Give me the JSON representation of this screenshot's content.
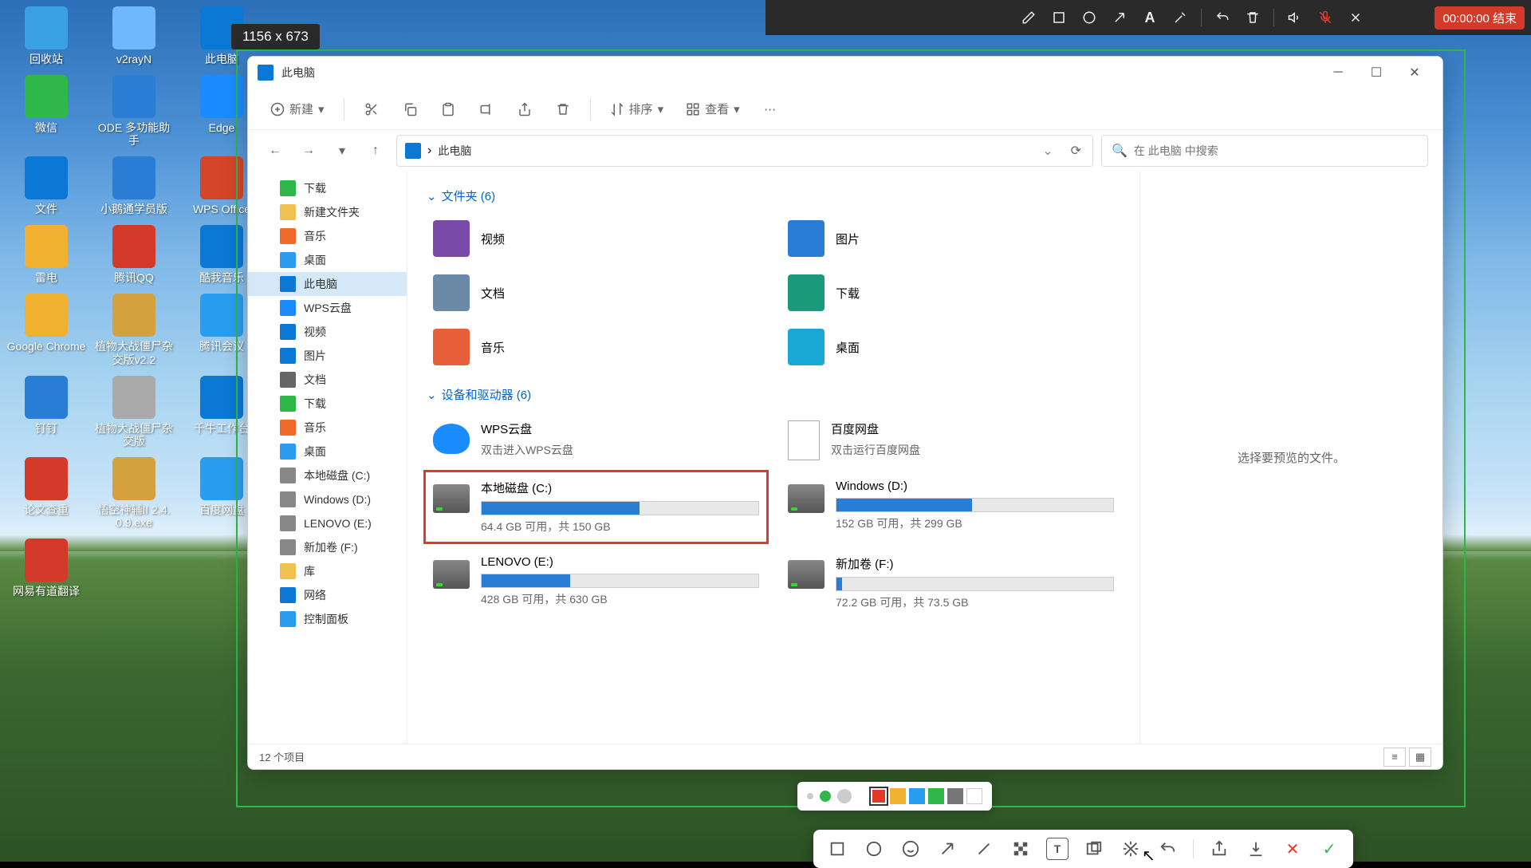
{
  "selection_label": "1156 x 673",
  "recording_time": "00:00:00 结束",
  "desktop_icons": [
    {
      "label": "回收站",
      "color": "#3aa0e4"
    },
    {
      "label": "v2rayN",
      "color": "#6fb8ff"
    },
    {
      "label": "此电脑",
      "color": "#0a78d4"
    },
    {
      "label": "微信",
      "color": "#2fb84a"
    },
    {
      "label": "ODE 多功能助手",
      "color": "#2a7dd4"
    },
    {
      "label": "Edge",
      "color": "#1a8cff"
    },
    {
      "label": "文件",
      "color": "#0a78d4"
    },
    {
      "label": "小鹅通学员版",
      "color": "#2a7dd4"
    },
    {
      "label": "WPS Office",
      "color": "#d4452a"
    },
    {
      "label": "雷电",
      "color": "#f0b030"
    },
    {
      "label": "腾讯QQ",
      "color": "#d43a2a"
    },
    {
      "label": "酷我音乐",
      "color": "#0a78d4"
    },
    {
      "label": "Google Chrome",
      "color": "#f0b030"
    },
    {
      "label": "植物大战僵尸杂交版v2.2",
      "color": "#d4a040"
    },
    {
      "label": "腾讯会议",
      "color": "#2a9df0"
    },
    {
      "label": "钉钉",
      "color": "#2a7dd4"
    },
    {
      "label": "植物大战僵尸杂交版",
      "color": "#aaa"
    },
    {
      "label": "千牛工作台",
      "color": "#0a78d4"
    },
    {
      "label": "论文查重",
      "color": "#d43a2a"
    },
    {
      "label": "悟空神辅II 2.4.0.9.exe",
      "color": "#d4a040"
    },
    {
      "label": "百度网盘",
      "color": "#2a9df0"
    },
    {
      "label": "网易有道翻译",
      "color": "#d43a2a"
    }
  ],
  "explorer": {
    "title": "此电脑",
    "new_btn": "新建",
    "sort_btn": "排序",
    "view_btn": "查看",
    "breadcrumb": "此电脑",
    "search_placeholder": "在 此电脑 中搜索",
    "preview_msg": "选择要预览的文件。",
    "status": "12 个项目",
    "nav": [
      {
        "label": "下载",
        "icon": "#2fb84a"
      },
      {
        "label": "新建文件夹",
        "icon": "#f0c050"
      },
      {
        "label": "音乐",
        "icon": "#f06a2a"
      },
      {
        "label": "桌面",
        "icon": "#2a9df0"
      },
      {
        "label": "此电脑",
        "icon": "#0a78d4",
        "sel": true
      },
      {
        "label": "WPS云盘",
        "icon": "#1a8cff"
      },
      {
        "label": "视频",
        "icon": "#0a78d4"
      },
      {
        "label": "图片",
        "icon": "#0a78d4"
      },
      {
        "label": "文档",
        "icon": "#666"
      },
      {
        "label": "下载",
        "icon": "#2fb84a"
      },
      {
        "label": "音乐",
        "icon": "#f06a2a"
      },
      {
        "label": "桌面",
        "icon": "#2a9df0"
      },
      {
        "label": "本地磁盘 (C:)",
        "icon": "#888"
      },
      {
        "label": "Windows (D:)",
        "icon": "#888"
      },
      {
        "label": "LENOVO (E:)",
        "icon": "#888"
      },
      {
        "label": "新加卷 (F:)",
        "icon": "#888"
      },
      {
        "label": "库",
        "icon": "#f0c050"
      },
      {
        "label": "网络",
        "icon": "#0a78d4"
      },
      {
        "label": "控制面板",
        "icon": "#2a9df0"
      }
    ],
    "folders_head": "文件夹 (6)",
    "folders": [
      {
        "label": "视频",
        "color": "#7a4aa8"
      },
      {
        "label": "图片",
        "color": "#2a7dd4"
      },
      {
        "label": "文档",
        "color": "#6a8aa8"
      },
      {
        "label": "下载",
        "color": "#1a9a7a"
      },
      {
        "label": "音乐",
        "color": "#e8603a"
      },
      {
        "label": "桌面",
        "color": "#1aa8d4"
      }
    ],
    "drives_head": "设备和驱动器 (6)",
    "clouds": [
      {
        "name": "WPS云盘",
        "sub": "双击进入WPS云盘",
        "type": "cloud"
      },
      {
        "name": "百度网盘",
        "sub": "双击运行百度网盘",
        "type": "file"
      }
    ],
    "drives": [
      {
        "name": "本地磁盘 (C:)",
        "sub": "64.4 GB 可用，共 150 GB",
        "pct": 57,
        "highlight": true
      },
      {
        "name": "Windows (D:)",
        "sub": "152 GB 可用，共 299 GB",
        "pct": 49
      },
      {
        "name": "LENOVO (E:)",
        "sub": "428 GB 可用，共 630 GB",
        "pct": 32
      },
      {
        "name": "新加卷 (F:)",
        "sub": "72.2 GB 可用，共 73.5 GB",
        "pct": 2
      }
    ]
  },
  "color_swatches": [
    "#e23a2a",
    "#f0b030",
    "#2a9df0",
    "#2fb84a",
    "#777",
    "#fff"
  ],
  "action_tools": [
    "rect",
    "circle",
    "emoji",
    "arrow",
    "line",
    "mosaic",
    "text",
    "copy",
    "pin",
    "undo"
  ]
}
